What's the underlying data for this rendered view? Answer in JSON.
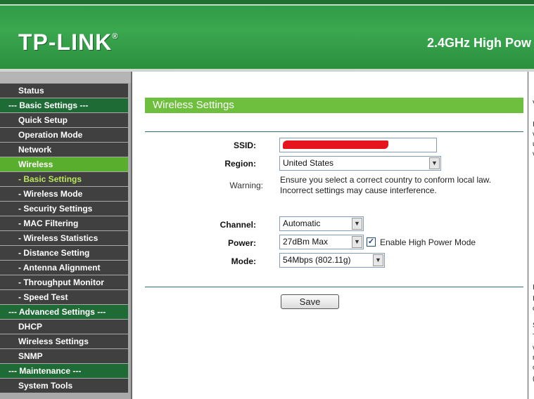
{
  "header": {
    "logo": "TP-LINK",
    "logo_mark": "®",
    "product": "2.4GHz High Pow"
  },
  "sidebar": {
    "items": [
      {
        "label": "Status",
        "kind": "top"
      },
      {
        "label": "--- Basic Settings ---",
        "kind": "section"
      },
      {
        "label": "Quick Setup",
        "kind": "top"
      },
      {
        "label": "Operation Mode",
        "kind": "top"
      },
      {
        "label": "Network",
        "kind": "top"
      },
      {
        "label": "Wireless",
        "kind": "active"
      },
      {
        "label": "- Basic Settings",
        "kind": "sub-current"
      },
      {
        "label": "- Wireless Mode",
        "kind": "sub"
      },
      {
        "label": "- Security Settings",
        "kind": "sub"
      },
      {
        "label": "- MAC Filtering",
        "kind": "sub"
      },
      {
        "label": "- Wireless Statistics",
        "kind": "sub"
      },
      {
        "label": "- Distance Setting",
        "kind": "sub"
      },
      {
        "label": "- Antenna Alignment",
        "kind": "sub"
      },
      {
        "label": "- Throughput Monitor",
        "kind": "sub"
      },
      {
        "label": "- Speed Test",
        "kind": "sub"
      },
      {
        "label": "--- Advanced Settings ---",
        "kind": "section"
      },
      {
        "label": "DHCP",
        "kind": "top"
      },
      {
        "label": "Wireless Settings",
        "kind": "top"
      },
      {
        "label": "SNMP",
        "kind": "top"
      },
      {
        "label": "--- Maintenance ---",
        "kind": "section"
      },
      {
        "label": "System Tools",
        "kind": "top"
      }
    ]
  },
  "main": {
    "title": "Wireless Settings",
    "ssid_label": "SSID:",
    "region_label": "Region:",
    "region_value": "United States",
    "warning_label": "Warning:",
    "warning_line1": "Ensure you select a correct country to conform local law.",
    "warning_line2": "Incorrect settings may cause interference.",
    "channel_label": "Channel:",
    "channel_value": "Automatic",
    "power_label": "Power:",
    "power_value": "27dBm Max",
    "high_power_checked": true,
    "high_power_label": "Enable High Power Mode",
    "mode_label": "Mode:",
    "mode_value": "54Mbps (802.11g)",
    "save_label": "Save"
  },
  "right_panel": {
    "letters": [
      "V",
      "I",
      "v",
      "u",
      "v",
      "I",
      "I",
      "c",
      "S",
      "T",
      "v",
      "r",
      "c",
      "("
    ]
  },
  "colors": {
    "header_green": "#3aa84f",
    "section_green": "#1f6b35",
    "active_green": "#5aae2e",
    "title_green": "#6ebf3d",
    "menu_dark": "#404040"
  }
}
